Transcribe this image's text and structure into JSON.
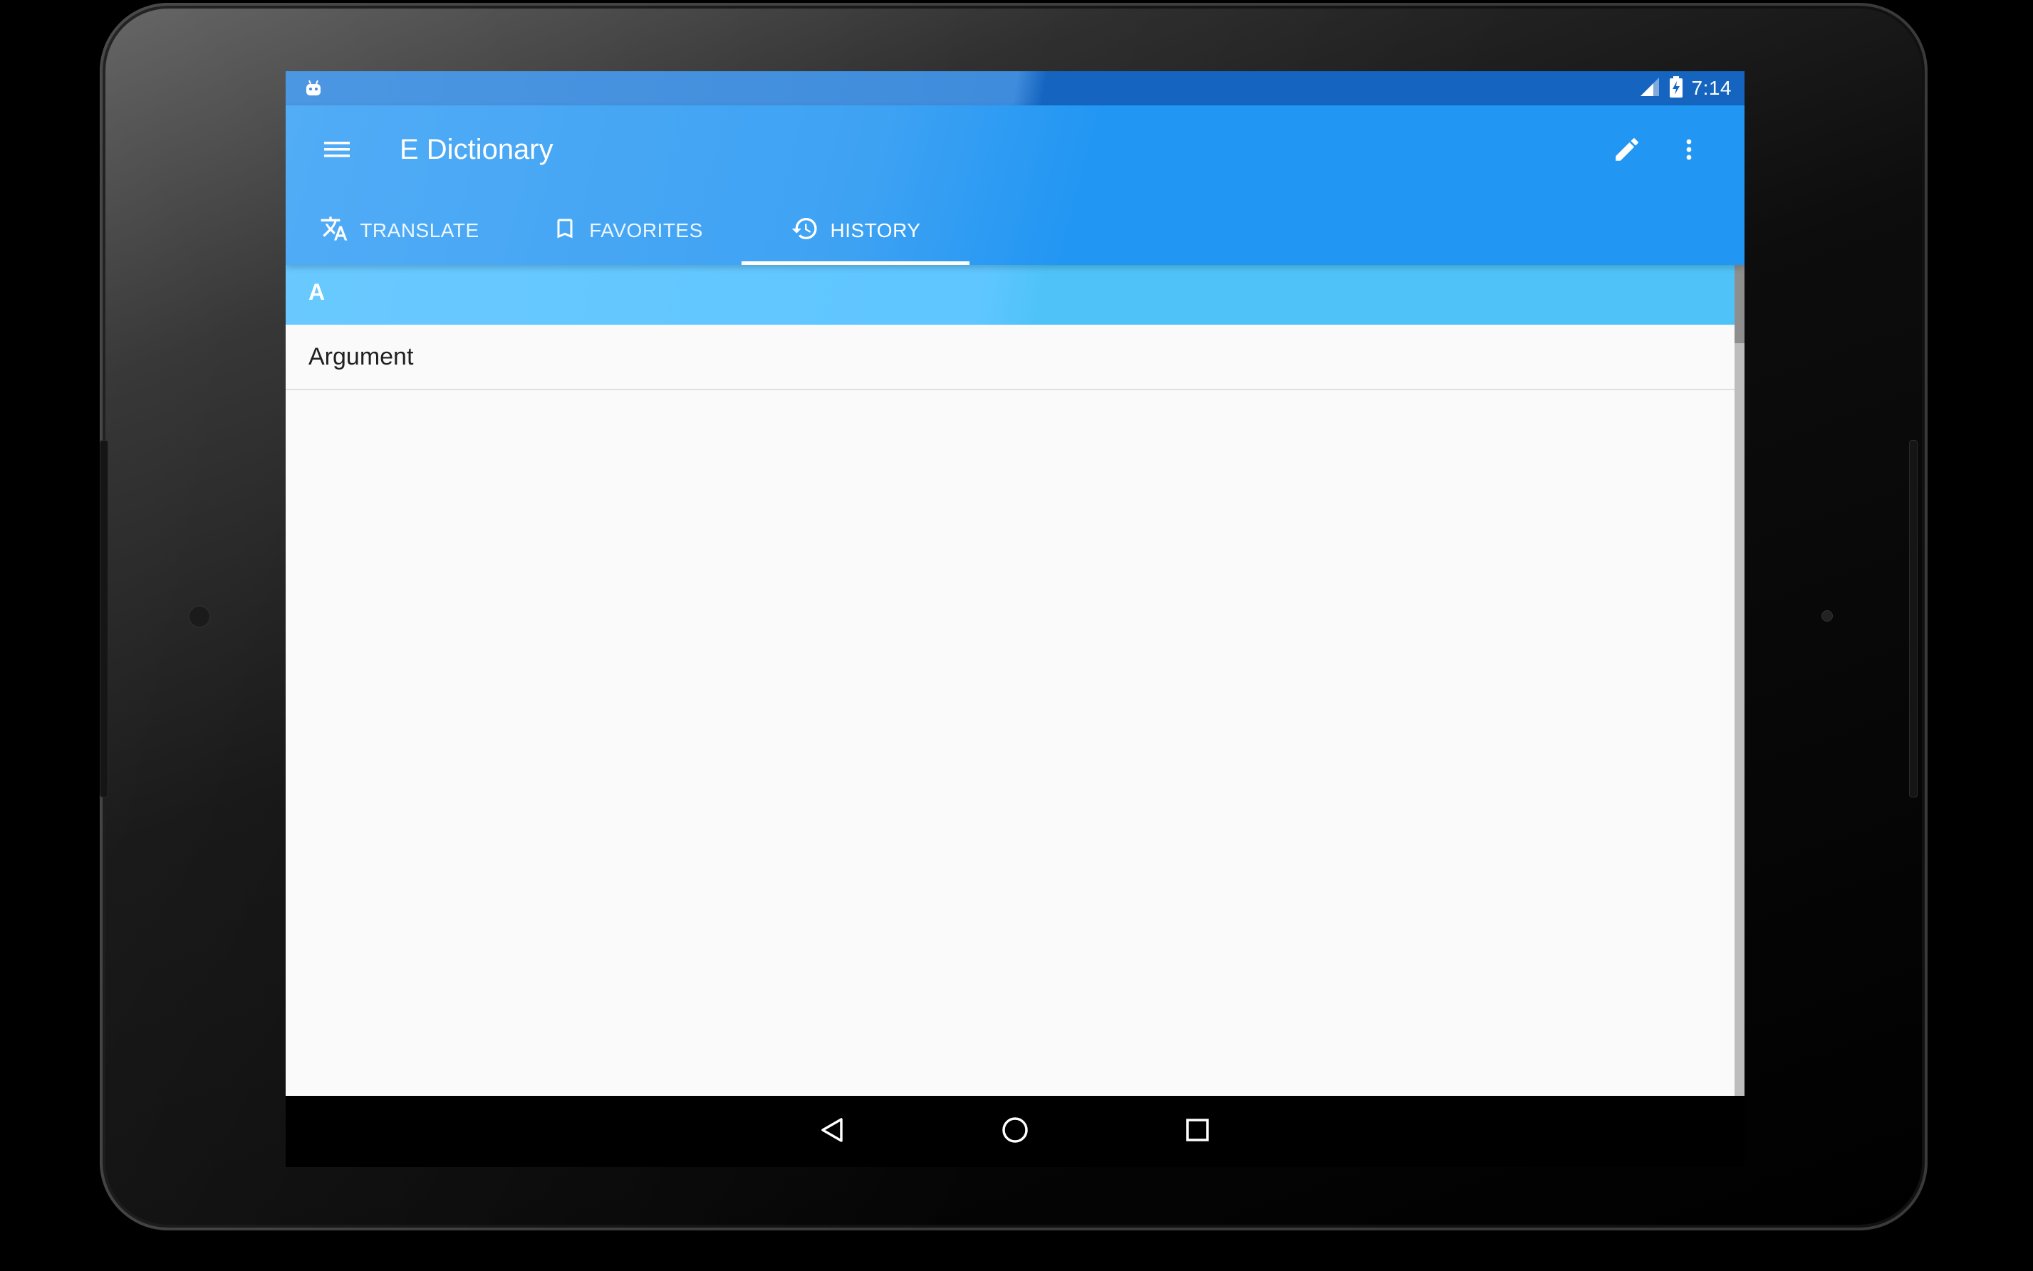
{
  "status_bar": {
    "time": "7:14",
    "notification_icon": "android-icon",
    "signal_icon": "signal-icon",
    "battery_icon": "battery-charging-icon"
  },
  "app_bar": {
    "title": "E Dictionary",
    "menu_icon": "menu-icon",
    "edit_icon": "pencil-icon",
    "overflow_icon": "more-vert-icon",
    "color_primary": "#2196f3"
  },
  "tabs": [
    {
      "label": "TRANSLATE",
      "icon": "translate-icon",
      "active": false
    },
    {
      "label": "FAVORITES",
      "icon": "bookmark-icon",
      "active": false
    },
    {
      "label": "HISTORY",
      "icon": "history-icon",
      "active": true
    }
  ],
  "history": {
    "section_letter": "A",
    "section_color": "#4fc3f7",
    "items": [
      "Argument"
    ]
  },
  "nav_bar": {
    "back_icon": "back-icon",
    "home_icon": "home-icon",
    "recents_icon": "recents-icon"
  }
}
